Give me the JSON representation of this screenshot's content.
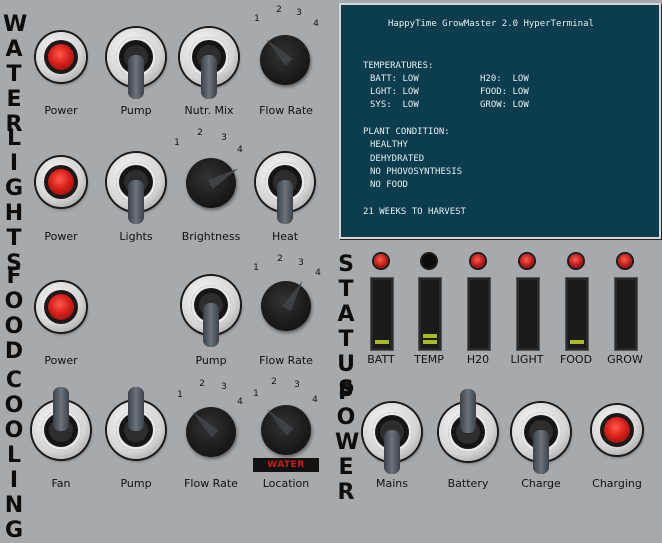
{
  "sections": {
    "water": "WATER",
    "lights": "LIGHTS",
    "food": "FOOD",
    "cooling": "COOLING",
    "status": "STATUS",
    "power": "POWER"
  },
  "water": {
    "power_label": "Power",
    "pump_label": "Pump",
    "nutr_mix_label": "Nutr. Mix",
    "flow_rate_label": "Flow Rate"
  },
  "lights": {
    "power_label": "Power",
    "lights_label": "Lights",
    "brightness_label": "Brightness",
    "heat_label": "Heat"
  },
  "food": {
    "power_label": "Power",
    "pump_label": "Pump",
    "flow_rate_label": "Flow Rate"
  },
  "cooling": {
    "fan_label": "Fan",
    "pump_label": "Pump",
    "flow_rate_label": "Flow Rate",
    "location_label": "Location",
    "location_value": "WATER"
  },
  "power": {
    "mains_label": "Mains",
    "battery_label": "Battery",
    "charge_label": "Charge",
    "charging_label": "Charging"
  },
  "knob_ticks": [
    "1",
    "2",
    "3",
    "4"
  ],
  "knob_positions": {
    "water_flow_rate": 1,
    "lights_brightness": 4,
    "food_flow_rate": 3,
    "cooling_flow_rate": 1,
    "cooling_location": 1
  },
  "terminal": {
    "title": "HappyTime GrowMaster 2.0 HyperTerminal",
    "temps_heading": "TEMPERATURES:",
    "batt": "BATT: LOW",
    "h2o": "H20:  LOW",
    "lght": "LGHT: LOW",
    "food": "FOOD: LOW",
    "sys": "SYS:  LOW",
    "grow": "GROW: LOW",
    "plant_heading": "PLANT CONDITION:",
    "cond1": "HEALTHY",
    "cond2": "DEHYDRATED",
    "cond3": "NO PHOVOSYNTHESIS",
    "cond4": "NO FOOD",
    "harvest": "21 WEEKS TO HARVEST"
  },
  "status_meters": [
    {
      "label": "BATT",
      "led": "red",
      "level_segments": 1
    },
    {
      "label": "TEMP",
      "led": "off",
      "level_segments": 2
    },
    {
      "label": "H20",
      "led": "red",
      "level_segments": 0
    },
    {
      "label": "LIGHT",
      "led": "red",
      "level_segments": 0
    },
    {
      "label": "FOOD",
      "led": "red",
      "level_segments": 1
    },
    {
      "label": "GROW",
      "led": "red",
      "level_segments": 0
    }
  ],
  "colors": {
    "panel": "#a7aaad",
    "terminal_bg": "#0b3d4d",
    "led_red": "#d8201a",
    "meter_green": "#a8ba26"
  }
}
